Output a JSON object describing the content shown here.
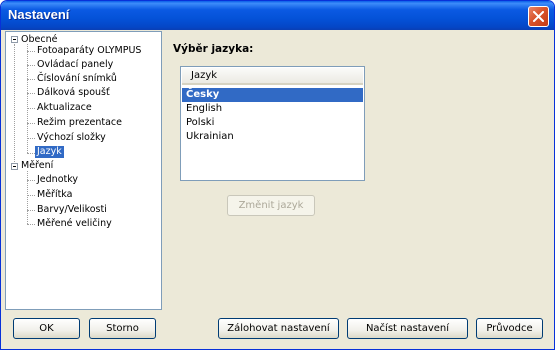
{
  "window": {
    "title": "Nastavení"
  },
  "tree": {
    "groups": [
      {
        "label": "Obecné",
        "items": [
          "Fotoaparáty OLYMPUS",
          "Ovládací panely",
          "Číslování snímků",
          "Dálková spoušť",
          "Aktualizace",
          "Režim prezentace",
          "Výchozí složky",
          "Jazyk"
        ]
      },
      {
        "label": "Měření",
        "items": [
          "Jednotky",
          "Měřítka",
          "Barvy/Velikosti",
          "Měřené veličiny"
        ]
      }
    ],
    "selected": "Jazyk"
  },
  "language_panel": {
    "heading": "Výběr jazyka:",
    "column_header": "Jazyk",
    "languages": [
      "Česky",
      "English",
      "Polski",
      "Ukrainian"
    ],
    "selected": "Česky",
    "change_button": "Změnit jazyk"
  },
  "footer": {
    "ok": "OK",
    "cancel": "Storno",
    "backup": "Zálohovat nastavení",
    "load": "Načíst nastavení",
    "wizard": "Průvodce"
  },
  "colors": {
    "selection": "#316ac5",
    "titlebar": "#0452d8",
    "face": "#ece9d8"
  }
}
